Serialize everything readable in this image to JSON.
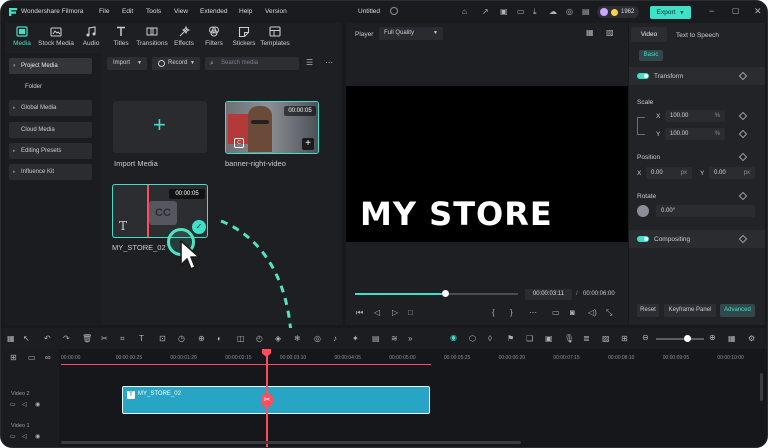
{
  "app": {
    "title": "Wondershare Filmora",
    "menu": [
      "File",
      "Edit",
      "Tools",
      "View",
      "Extended",
      "Help",
      "Version"
    ],
    "project_title": "Untitled",
    "credits": "1962",
    "export_label": "Export"
  },
  "media_tabs": [
    {
      "label": "Media",
      "icon": "media-icon"
    },
    {
      "label": "Stock Media",
      "icon": "stock-media-icon"
    },
    {
      "label": "Audio",
      "icon": "music-icon"
    },
    {
      "label": "Titles",
      "icon": "titles-icon"
    },
    {
      "label": "Transitions",
      "icon": "transitions-icon"
    },
    {
      "label": "Effects",
      "icon": "effects-icon"
    },
    {
      "label": "Filters",
      "icon": "filters-icon"
    },
    {
      "label": "Stickers",
      "icon": "stickers-icon"
    },
    {
      "label": "Templates",
      "icon": "templates-icon"
    }
  ],
  "sidebar": {
    "items": [
      {
        "label": "Project Media",
        "expanded": true
      },
      {
        "label": "Folder",
        "expanded": false
      },
      {
        "label": "Global Media",
        "expanded": false
      },
      {
        "label": "Cloud Media",
        "expanded": false
      },
      {
        "label": "Editing Presets",
        "expanded": false
      },
      {
        "label": "Influence Kit",
        "expanded": false
      }
    ]
  },
  "media_toolbar": {
    "import_label": "Import",
    "record_label": "Record",
    "search_placeholder": "Search media"
  },
  "media_items": [
    {
      "name": "Import Media",
      "duration": ""
    },
    {
      "name": "banner-right-video",
      "duration": "00:00:05"
    },
    {
      "name": "MY_STORE_02",
      "duration": "00:00:05",
      "label": "CC"
    }
  ],
  "player": {
    "label": "Player",
    "quality": "Full Quality",
    "overlay_text": "MY STORE",
    "current_time": "00:00:03:11",
    "total_time": "00:00:06:00",
    "progress": 0.55
  },
  "inspector": {
    "tabs": [
      "Video",
      "Text to Speech"
    ],
    "subtab": "Basic",
    "transform_label": "Transform",
    "scale_label": "Scale",
    "scale_x_label": "X",
    "scale_y_label": "Y",
    "scale_x": "100.00",
    "scale_y": "100.00",
    "percent_unit": "%",
    "position_label": "Position",
    "pos_x_label": "X",
    "pos_y_label": "Y",
    "pos_x": "0.00",
    "pos_y": "0.00",
    "px_unit": "px",
    "rotate_label": "Rotate",
    "rotate_value": "0.00°",
    "compositing_label": "Compositing",
    "reset_label": "Reset",
    "keyframe_label": "Keyframe Panel",
    "advanced_label": "Advanced"
  },
  "timeline": {
    "ruler": [
      "00:00:00",
      "00:00:00:25",
      "00:00:01:20",
      "00:00:02:15",
      "00:00:03:10",
      "00:00:04:05",
      "00:00:05:00",
      "00:00:05:25",
      "00:00:06:20",
      "00:00:07:15",
      "00:00:08:10",
      "00:00:09:05",
      "00:00:10:00",
      "00:00:10:25"
    ],
    "tracks": [
      {
        "label": "Video 2"
      },
      {
        "label": "Video 1"
      }
    ],
    "clip_label": "MY_STORE_02",
    "clip_icon": "T"
  },
  "colors": {
    "accent": "#3ee0c8",
    "clip": "#28a5c4",
    "playhead": "#ff4d5e",
    "background": "#18191c"
  }
}
